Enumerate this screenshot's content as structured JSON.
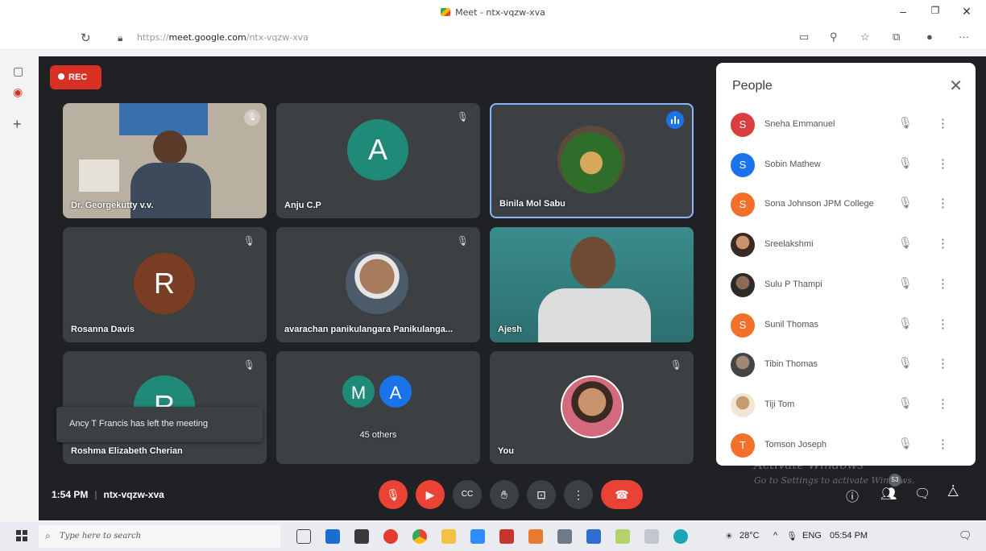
{
  "browser": {
    "tab_title": "Meet - ntx-vqzw-xva",
    "url_prefix": "https://",
    "url_host": "meet.google.com",
    "url_path": "/ntx-vqzw-xva"
  },
  "meet": {
    "rec_label": "REC",
    "tiles": [
      {
        "name": "Dr. Georgekutty v.v.",
        "type": "video"
      },
      {
        "name": "Anju C.P",
        "type": "letter",
        "letter": "A",
        "color": "#1f8a78"
      },
      {
        "name": "Binila Mol Sabu",
        "type": "photo",
        "speaking": true
      },
      {
        "name": "Rosanna Davis",
        "type": "letter",
        "letter": "R",
        "color": "#7a3e25"
      },
      {
        "name": "avarachan panikulangara Panikulanga...",
        "type": "photo"
      },
      {
        "name": "Ajesh",
        "type": "video"
      },
      {
        "name": "Roshma Elizabeth Cherian",
        "type": "letter",
        "letter": "R",
        "color": "#1f8a78"
      },
      {
        "name": "45 others",
        "type": "others",
        "letters": [
          "M",
          "A"
        ]
      },
      {
        "name": "You",
        "type": "photo"
      }
    ],
    "toast": "Ancy T Francis has left the meeting",
    "time": "1:54 PM",
    "meeting_code": "ntx-vqzw-xva",
    "participant_count": "53",
    "watermark_line1": "Activate Windows",
    "watermark_line2": "Go to Settings to activate Windows."
  },
  "people_panel": {
    "title": "People",
    "participants": [
      {
        "name": "Sneha Emmanuel",
        "initial": "S",
        "color": "#d93f3f"
      },
      {
        "name": "Sobin Mathew",
        "initial": "S",
        "color": "#1a73e8"
      },
      {
        "name": "Sona Johnson JPM College",
        "initial": "S",
        "color": "#f2702a"
      },
      {
        "name": "Sreelakshmi",
        "initial": "",
        "color": "#9aa0a6"
      },
      {
        "name": "Sulu P Thampi",
        "initial": "",
        "color": "#5f6368"
      },
      {
        "name": "Sunil Thomas",
        "initial": "S",
        "color": "#f2702a"
      },
      {
        "name": "Tibin Thomas",
        "initial": "",
        "color": "#80868b"
      },
      {
        "name": "Tiji Tom",
        "initial": "",
        "color": "#c69c6d"
      },
      {
        "name": "Tomson Joseph",
        "initial": "T",
        "color": "#f2702a"
      }
    ]
  },
  "taskbar": {
    "search_placeholder": "Type here to search",
    "temperature": "28°C",
    "language": "ENG",
    "clock": "05:54 PM"
  }
}
